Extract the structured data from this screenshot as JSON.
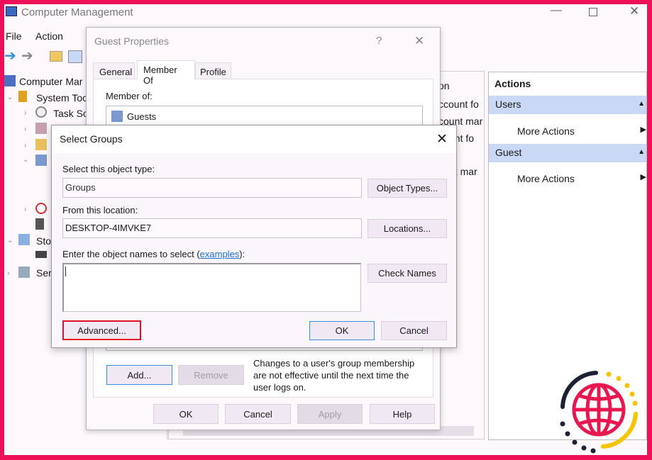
{
  "window": {
    "title": "Computer Management"
  },
  "menu": [
    "File",
    "Action"
  ],
  "tree": {
    "root": "Computer Mar",
    "system_tools": "System Toc",
    "task_scheduler": "Task Sch",
    "storage": "Sto",
    "services": "Ser"
  },
  "middle": {
    "fragments": [
      "on",
      "ccount fo",
      "count mar",
      "unt fo",
      "nt mar"
    ]
  },
  "actions": {
    "header": "Actions",
    "sections": [
      {
        "title": "Users",
        "item": "More Actions"
      },
      {
        "title": "Guest",
        "item": "More Actions"
      }
    ]
  },
  "guest_props": {
    "title": "Guest Properties",
    "help": "?",
    "tabs": [
      "General",
      "Member Of",
      "Profile"
    ],
    "active_tab": "Member Of",
    "member_of_label": "Member of:",
    "members": [
      "Guests"
    ],
    "add": "Add...",
    "remove": "Remove",
    "note": "Changes to a user's group membership are not effective until the next time the user logs on.",
    "ok": "OK",
    "cancel": "Cancel",
    "apply": "Apply",
    "help_btn": "Help"
  },
  "select_groups": {
    "title": "Select Groups",
    "object_type_label": "Select this object type:",
    "object_type": "Groups",
    "object_types_btn": "Object Types...",
    "location_label": "From this location:",
    "location": "DESKTOP-4IMVKE7",
    "locations_btn": "Locations...",
    "names_label_pre": "Enter the object names to select (",
    "names_link": "examples",
    "names_label_post": "):",
    "names_value": "",
    "check_names": "Check Names",
    "advanced": "Advanced...",
    "ok": "OK",
    "cancel": "Cancel"
  },
  "colors": {
    "frame": "#f0105a",
    "highlight": "#e0102a",
    "band": "#c9d8f4",
    "link": "#1a6fd6"
  }
}
